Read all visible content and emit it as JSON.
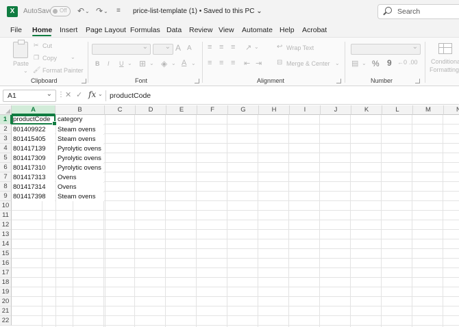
{
  "window": {
    "autosave_label": "AutoSave",
    "autosave_state": "Off",
    "document_title": "price-list-template (1) • Saved to this PC ⌄",
    "search_placeholder": "Search",
    "app_icon": "excel-logo-icon",
    "quick_access_icons": [
      "undo-icon",
      "redo-icon",
      "customize-icon"
    ]
  },
  "menu": {
    "tabs": [
      "File",
      "Home",
      "Insert",
      "Page Layout",
      "Formulas",
      "Data",
      "Review",
      "View",
      "Automate",
      "Help",
      "Acrobat"
    ],
    "active_tab": "Home"
  },
  "ribbon": {
    "clipboard": {
      "label": "Clipboard",
      "paste": "Paste",
      "cut": "Cut",
      "copy": "Copy",
      "format_painter": "Format Painter"
    },
    "font": {
      "label": "Font",
      "bold": "B",
      "italic": "I",
      "underline": "U",
      "grow": "A",
      "shrink": "A"
    },
    "alignment": {
      "label": "Alignment",
      "wrap_text": "Wrap Text",
      "merge_center": "Merge & Center"
    },
    "number": {
      "label": "Number",
      "percent": "%",
      "comma": "9"
    },
    "styles": {
      "conditional_formatting_line1": "Conditional",
      "conditional_formatting_line2": "Formatting"
    }
  },
  "formula_bar": {
    "name_box": "A1",
    "fx": "fx",
    "content": "productCode"
  },
  "sheet": {
    "columns": [
      "A",
      "B",
      "C",
      "D",
      "E",
      "F",
      "G",
      "H",
      "I",
      "J",
      "K",
      "L",
      "M",
      "N"
    ],
    "selected_column": "A",
    "row_numbers": [
      "1",
      "2",
      "3",
      "4",
      "5",
      "6",
      "7",
      "8",
      "9",
      "10",
      "11",
      "12",
      "13",
      "14",
      "15",
      "16",
      "17",
      "18",
      "19",
      "20",
      "21",
      "22"
    ],
    "selected_row": "1",
    "data": [
      [
        "productCode",
        "category"
      ],
      [
        "801409922",
        "Steam ovens"
      ],
      [
        "801415405",
        "Steam ovens"
      ],
      [
        "801417139",
        "Pyrolytic ovens"
      ],
      [
        "801417309",
        "Pyrolytic ovens"
      ],
      [
        "801417310",
        "Pyrolytic ovens"
      ],
      [
        "801417313",
        "Ovens"
      ],
      [
        "801417314",
        "Ovens"
      ],
      [
        "801417398",
        "Steam ovens"
      ]
    ]
  },
  "colors": {
    "accent": "#107c41",
    "header_bg": "#f3f3f3",
    "gridline": "#e3e3e3"
  }
}
